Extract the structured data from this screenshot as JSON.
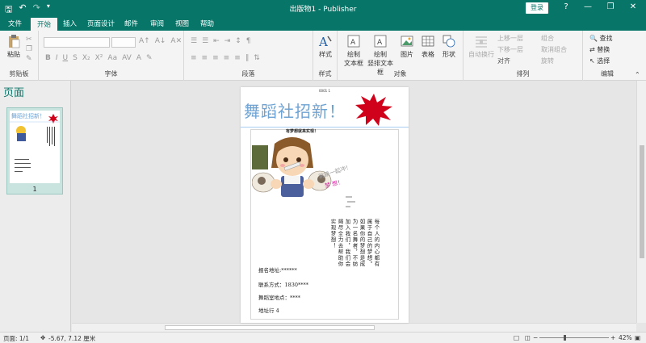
{
  "window": {
    "title": "出版物1 - Publisher",
    "login": "登录",
    "help": "?"
  },
  "tabs": [
    "文件",
    "开始",
    "插入",
    "页面设计",
    "邮件",
    "审阅",
    "视图",
    "帮助"
  ],
  "ribbon": {
    "clipboard": {
      "paste": "粘贴",
      "label": "剪贴板"
    },
    "font": {
      "label": "字体"
    },
    "paragraph": {
      "label": "段落"
    },
    "styles": {
      "style": "样式",
      "label": "样式"
    },
    "objects": {
      "textbox1": "绘制",
      "textbox2": "文本框",
      "vtext1": "绘制",
      "vtext2": "竖排文本框",
      "picture": "图片",
      "table": "表格",
      "shape": "形状",
      "label": "对象"
    },
    "arrange": {
      "autowrap": "自动换行",
      "bring_forward": "上移一层",
      "send_backward": "下移一层",
      "align": "对齐",
      "group": "组合",
      "ungroup": "取消组合",
      "rotate": "旋转",
      "label": "排列"
    },
    "editing": {
      "find": "查找",
      "replace": "替换",
      "select": "选择",
      "label": "编辑"
    }
  },
  "left_pane": {
    "heading": "页面",
    "page_number": "1"
  },
  "publication": {
    "page_num": "0001 1",
    "headline": "舞蹈社招新！",
    "dream_line": "有梦想就来实现！",
    "col1": [
      "每个人的内心都有",
      "属于自己的梦想。",
      "如果你的梦想是成",
      "为一名舞者，不妨",
      "加入我们，我们会",
      "竭尽全力去帮助你",
      "实现梦想！"
    ],
    "slogan": "跳跳一起冲！",
    "slogan2": "梦 想！",
    "info": [
      "报名地址:******",
      "联系方式：1830****",
      "舞蹈室地点：****",
      "地址行 4"
    ]
  },
  "status": {
    "page": "页面: 1/1",
    "coords": "-5.67, 7.12 厘米",
    "zoom": "42%"
  },
  "colors": {
    "accent": "#077568",
    "headline": "#6fa3d3",
    "burst": "#d0021b"
  }
}
